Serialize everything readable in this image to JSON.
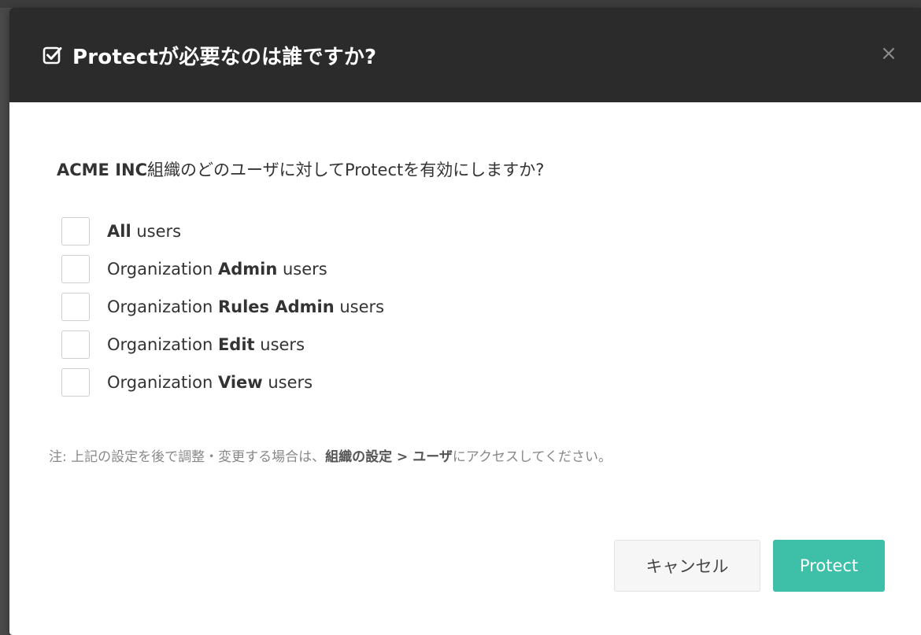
{
  "dialog": {
    "title": "Protectが必要なのは誰ですか?",
    "close_label": "×",
    "question_bold": "ACME INC",
    "question_rest": "組織のどのユーザに対してProtectを有効にしますか?",
    "options": [
      {
        "prefix": "",
        "bold": "All",
        "suffix": "users"
      },
      {
        "prefix": "Organization",
        "bold": "Admin",
        "suffix": "users"
      },
      {
        "prefix": "Organization",
        "bold": "Rules Admin",
        "suffix": "users"
      },
      {
        "prefix": "Organization",
        "bold": "Edit",
        "suffix": "users"
      },
      {
        "prefix": "Organization",
        "bold": "View",
        "suffix": "users"
      }
    ],
    "note_prefix": "注: 上記の設定を後で調整・変更する場合は、",
    "note_strong": "組織の設定 > ユーザ",
    "note_suffix": "にアクセスしてください。",
    "cancel_label": "キャンセル",
    "protect_label": "Protect"
  },
  "colors": {
    "header_bg": "#2b2b2b",
    "primary": "#3dbfa8"
  },
  "icons": {
    "title": "checkbox-checked-icon",
    "close": "close-icon"
  }
}
